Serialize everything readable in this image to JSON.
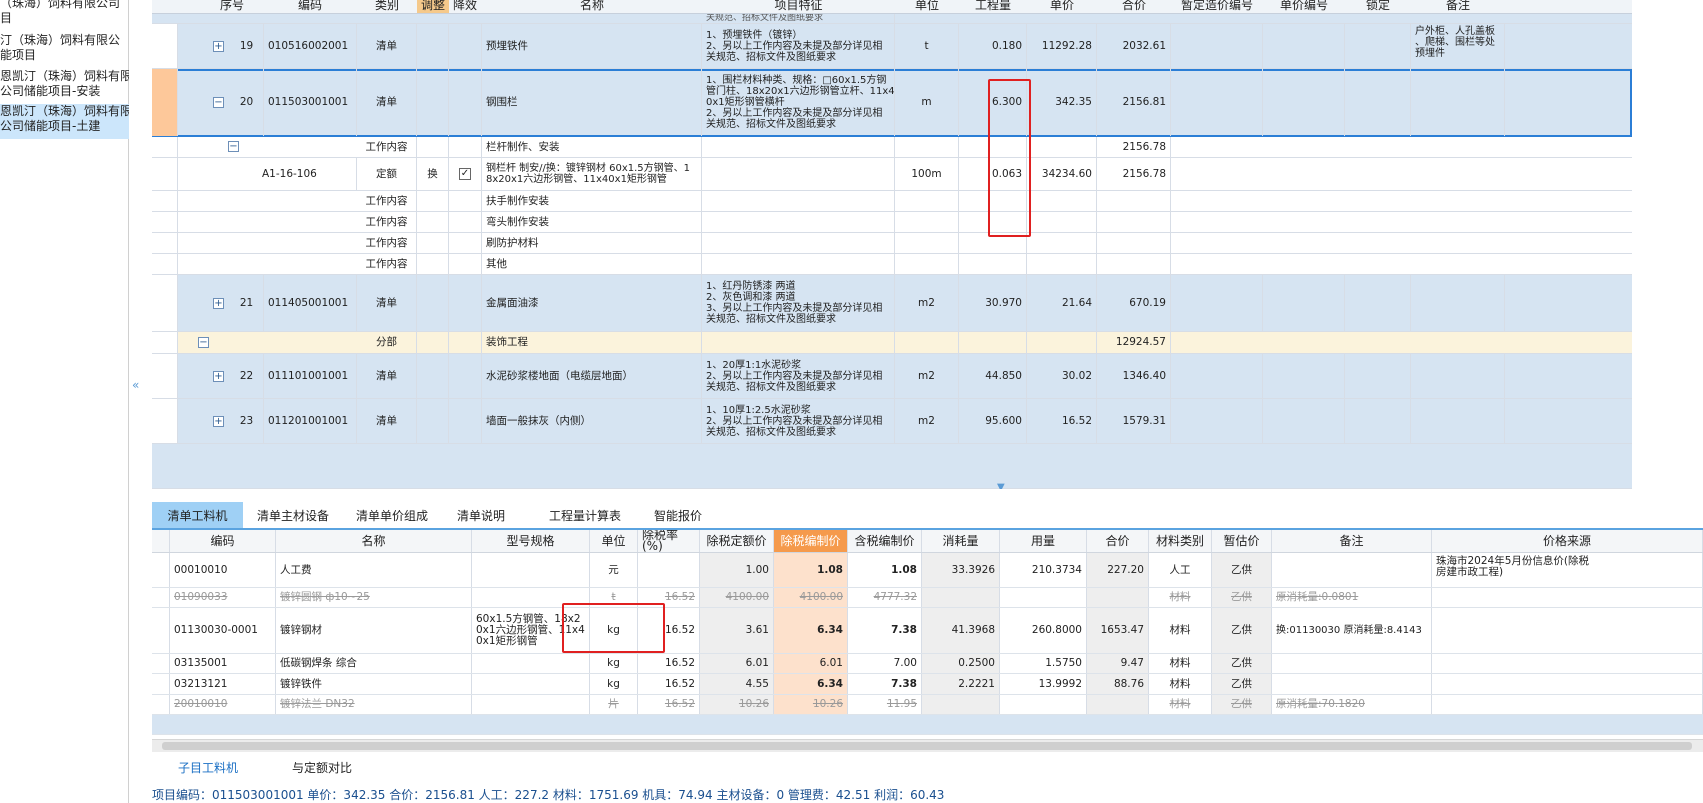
{
  "left_panel": {
    "items": [
      {
        "text": "（珠海）饲料有限公司\n目"
      },
      {
        "text": "汀（珠海）饲料有限公\n能项目"
      },
      {
        "text": "恩凯汀（珠海）饲料有限\n公司储能项目-安装"
      },
      {
        "text": "恩凯汀（珠海）饲料有限\n公司储能项目-土建",
        "selected": true
      }
    ]
  },
  "grid": {
    "headers": [
      "序号",
      "编码",
      "类别",
      "调整",
      "降效",
      "名称",
      "项目特征",
      "单位",
      "工程量",
      "单价",
      "合价",
      "暂定造价编号",
      "单价编号",
      "锁定",
      "备注"
    ],
    "rows": [
      {
        "kind": "qd",
        "seq": "19",
        "code": "010516002001",
        "cat": "清单",
        "name": "预埋铁件",
        "feature": "1、预埋铁件（镀锌）\n2、另以上工作内容及未提及部分详见相\n关规范、招标文件及图纸要求",
        "unit": "t",
        "qty": "0.180",
        "price": "11292.28",
        "total": "2032.61",
        "remark": "户外柜、人孔盖板\n、爬梯、围栏等处\n预埋件"
      },
      {
        "kind": "qd",
        "seq": "20",
        "code": "011503001001",
        "cat": "清单",
        "name": "钢围栏",
        "feature": "1、围栏材料种类、规格：□60x1.5方钢\n管门柱、18x20x1六边形钢管立杆、11x4\n0x1矩形钢管横杆\n2、另以上工作内容及未提及部分详见相\n关规范、招标文件及图纸要求",
        "unit": "m",
        "qty": "6.300",
        "price": "342.35",
        "total": "2156.81",
        "remark": ""
      },
      {
        "kind": "wk",
        "seq": "",
        "code": "",
        "cat": "工作内容",
        "name": "栏杆制作、安装",
        "feature": "",
        "unit": "",
        "qty": "",
        "price": "",
        "total": "2156.78",
        "remark": ""
      },
      {
        "kind": "de",
        "seq": "",
        "code": "A1-16-106",
        "cat": "定额",
        "adj": "换",
        "name": "钢栏杆 制安//换：镀锌钢材 60x1.5方钢管、1\n8x20x1六边形钢管、11x40x1矩形钢管",
        "feature": "",
        "unit": "100m",
        "qty": "0.063",
        "price": "34234.60",
        "total": "2156.78",
        "remark": ""
      },
      {
        "kind": "wk",
        "seq": "",
        "code": "",
        "cat": "工作内容",
        "name": "扶手制作安装",
        "feature": "",
        "unit": "",
        "qty": "",
        "price": "",
        "total": "",
        "remark": ""
      },
      {
        "kind": "wk",
        "seq": "",
        "code": "",
        "cat": "工作内容",
        "name": "弯头制作安装",
        "feature": "",
        "unit": "",
        "qty": "",
        "price": "",
        "total": "",
        "remark": ""
      },
      {
        "kind": "wk",
        "seq": "",
        "code": "",
        "cat": "工作内容",
        "name": "刷防护材料",
        "feature": "",
        "unit": "",
        "qty": "",
        "price": "",
        "total": "",
        "remark": ""
      },
      {
        "kind": "wk",
        "seq": "",
        "code": "",
        "cat": "工作内容",
        "name": "其他",
        "feature": "",
        "unit": "",
        "qty": "",
        "price": "",
        "total": "",
        "remark": ""
      },
      {
        "kind": "qd",
        "seq": "21",
        "code": "011405001001",
        "cat": "清单",
        "name": "金属面油漆",
        "feature": "1、红丹防锈漆 两道\n2、灰色调和漆 两道\n3、另以上工作内容及未提及部分详见相\n关规范、招标文件及图纸要求",
        "unit": "m2",
        "qty": "30.970",
        "price": "21.64",
        "total": "670.19",
        "remark": ""
      },
      {
        "kind": "fb",
        "seq": "",
        "code": "",
        "cat": "分部",
        "name": "装饰工程",
        "feature": "",
        "unit": "",
        "qty": "",
        "price": "",
        "total": "12924.57",
        "remark": ""
      },
      {
        "kind": "qd",
        "seq": "22",
        "code": "011101001001",
        "cat": "清单",
        "name": "水泥砂浆楼地面（电缆层地面）",
        "feature": "1、20厚1:1水泥砂浆\n2、另以上工作内容及未提及部分详见相\n关规范、招标文件及图纸要求",
        "unit": "m2",
        "qty": "44.850",
        "price": "30.02",
        "total": "1346.40",
        "remark": ""
      },
      {
        "kind": "qd",
        "seq": "23",
        "code": "011201001001",
        "cat": "清单",
        "name": "墙面一般抹灰（内侧）",
        "feature": "1、10厚1:2.5水泥砂浆\n2、另以上工作内容及未提及部分详见相\n关规范、招标文件及图纸要求",
        "unit": "m2",
        "qty": "95.600",
        "price": "16.52",
        "total": "1579.31",
        "remark": ""
      }
    ],
    "top_partial_feature": "关规范、招标文件及图纸要求"
  },
  "tabs": [
    "清单工料机",
    "清单主材设备",
    "清单单价组成",
    "清单说明",
    "工程量计算表",
    "智能报价"
  ],
  "bottom": {
    "headers": [
      "编码",
      "名称",
      "型号规格",
      "单位",
      "除税率(%)",
      "除税定额价",
      "除税编制价",
      "含税编制价",
      "消耗量",
      "用量",
      "合价",
      "材料类别",
      "暂估价",
      "备注",
      "价格来源"
    ],
    "rows": [
      {
        "code": "00010010",
        "name": "人工费",
        "spec": "",
        "unit": "元",
        "tax": "",
        "de": "1.00",
        "bz": "1.08",
        "hs": "1.08",
        "xh": "33.3926",
        "yl": "210.3734",
        "hj": "227.20",
        "lb": "人工",
        "zg": "乙供",
        "bz2": "",
        "src": "珠海市2024年5月份信息价(除税\n房建市政工程)"
      },
      {
        "code": "01090033",
        "name": "镀锌圆钢 ф10~25",
        "spec": "",
        "unit": "t",
        "tax": "16.52",
        "de": "4100.00",
        "bz": "4100.00",
        "hs": "4777.32",
        "xh": "",
        "yl": "",
        "hj": "",
        "lb": "材料",
        "zg": "乙供",
        "bz2": "原消耗量:0.0801",
        "src": "",
        "strike": true
      },
      {
        "code": "01130030-0001",
        "name": "镀锌钢材",
        "spec": "60x1.5方钢管、18x2\n0x1六边形钢管、11x4\n0x1矩形钢管",
        "unit": "kg",
        "tax": "16.52",
        "de": "3.61",
        "bz": "6.34",
        "hs": "7.38",
        "xh": "41.3968",
        "yl": "260.8000",
        "hj": "1653.47",
        "lb": "材料",
        "zg": "乙供",
        "bz2": "换:01130030 原消耗量:8.4143",
        "src": ""
      },
      {
        "code": "03135001",
        "name": "低碳钢焊条 综合",
        "spec": "",
        "unit": "kg",
        "tax": "16.52",
        "de": "6.01",
        "bz": "6.01",
        "hs": "7.00",
        "xh": "0.2500",
        "yl": "1.5750",
        "hj": "9.47",
        "lb": "材料",
        "zg": "乙供",
        "bz2": "",
        "src": ""
      },
      {
        "code": "03213121",
        "name": "镀锌铁件",
        "spec": "",
        "unit": "kg",
        "tax": "16.52",
        "de": "4.55",
        "bz": "6.34",
        "hs": "7.38",
        "xh": "2.2221",
        "yl": "13.9992",
        "hj": "88.76",
        "lb": "材料",
        "zg": "乙供",
        "bz2": "",
        "src": ""
      },
      {
        "code": "20010010",
        "name": "镀锌法兰 DN32",
        "spec": "",
        "unit": "片",
        "tax": "16.52",
        "de": "10.26",
        "bz": "10.26",
        "hs": "11.95",
        "xh": "",
        "yl": "",
        "hj": "",
        "lb": "材料",
        "zg": "乙供",
        "bz2": "原消耗量:70.1820",
        "src": "",
        "strike": true
      }
    ]
  },
  "sub_tabs": [
    "子目工料机",
    "与定额对比"
  ],
  "status_line": "项目编码：011503001001  单价：342.35  合价：2156.81  人工：227.2  材料：1751.69  机具：74.94  主材设备：0  管理费：42.51  利润：60.43"
}
